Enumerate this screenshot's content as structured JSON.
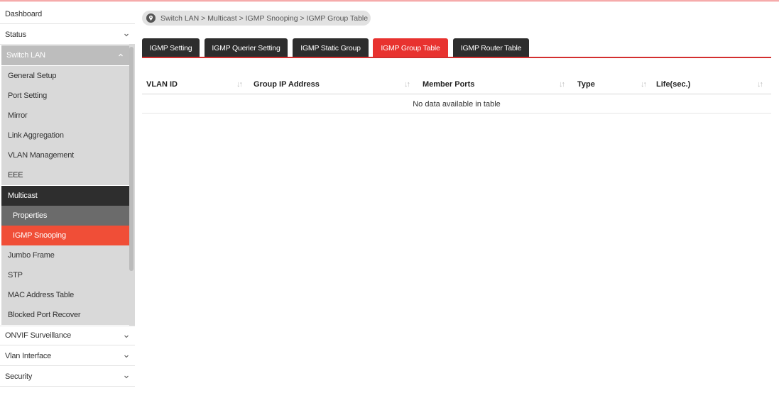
{
  "sidebar": {
    "items": [
      {
        "label": "Dashboard"
      },
      {
        "label": "Status"
      },
      {
        "label": "Switch LAN"
      },
      {
        "label": "General Setup"
      },
      {
        "label": "Port Setting"
      },
      {
        "label": "Mirror"
      },
      {
        "label": "Link Aggregation"
      },
      {
        "label": "VLAN Management"
      },
      {
        "label": "EEE"
      },
      {
        "label": "Multicast"
      },
      {
        "label": "Properties"
      },
      {
        "label": "IGMP Snooping"
      },
      {
        "label": "Jumbo Frame"
      },
      {
        "label": "STP"
      },
      {
        "label": "MAC Address Table"
      },
      {
        "label": "Blocked Port Recover"
      },
      {
        "label": "ONVIF Surveillance"
      },
      {
        "label": "Vlan Interface"
      },
      {
        "label": "Security"
      }
    ]
  },
  "breadcrumb": {
    "text": "Switch LAN > Multicast > IGMP Snooping > IGMP Group Table"
  },
  "tabs": [
    {
      "label": "IGMP Setting"
    },
    {
      "label": "IGMP Querier Setting"
    },
    {
      "label": "IGMP Static Group"
    },
    {
      "label": "IGMP Group Table"
    },
    {
      "label": "IGMP Router Table"
    }
  ],
  "table": {
    "columns": [
      "VLAN ID",
      "Group IP Address",
      "Member Ports",
      "Type",
      "Life(sec.)"
    ],
    "empty_message": "No data available in table"
  },
  "colors": {
    "accent": "#e8322f",
    "active_menu": "#f04e37",
    "dark": "#2d2d2d"
  }
}
